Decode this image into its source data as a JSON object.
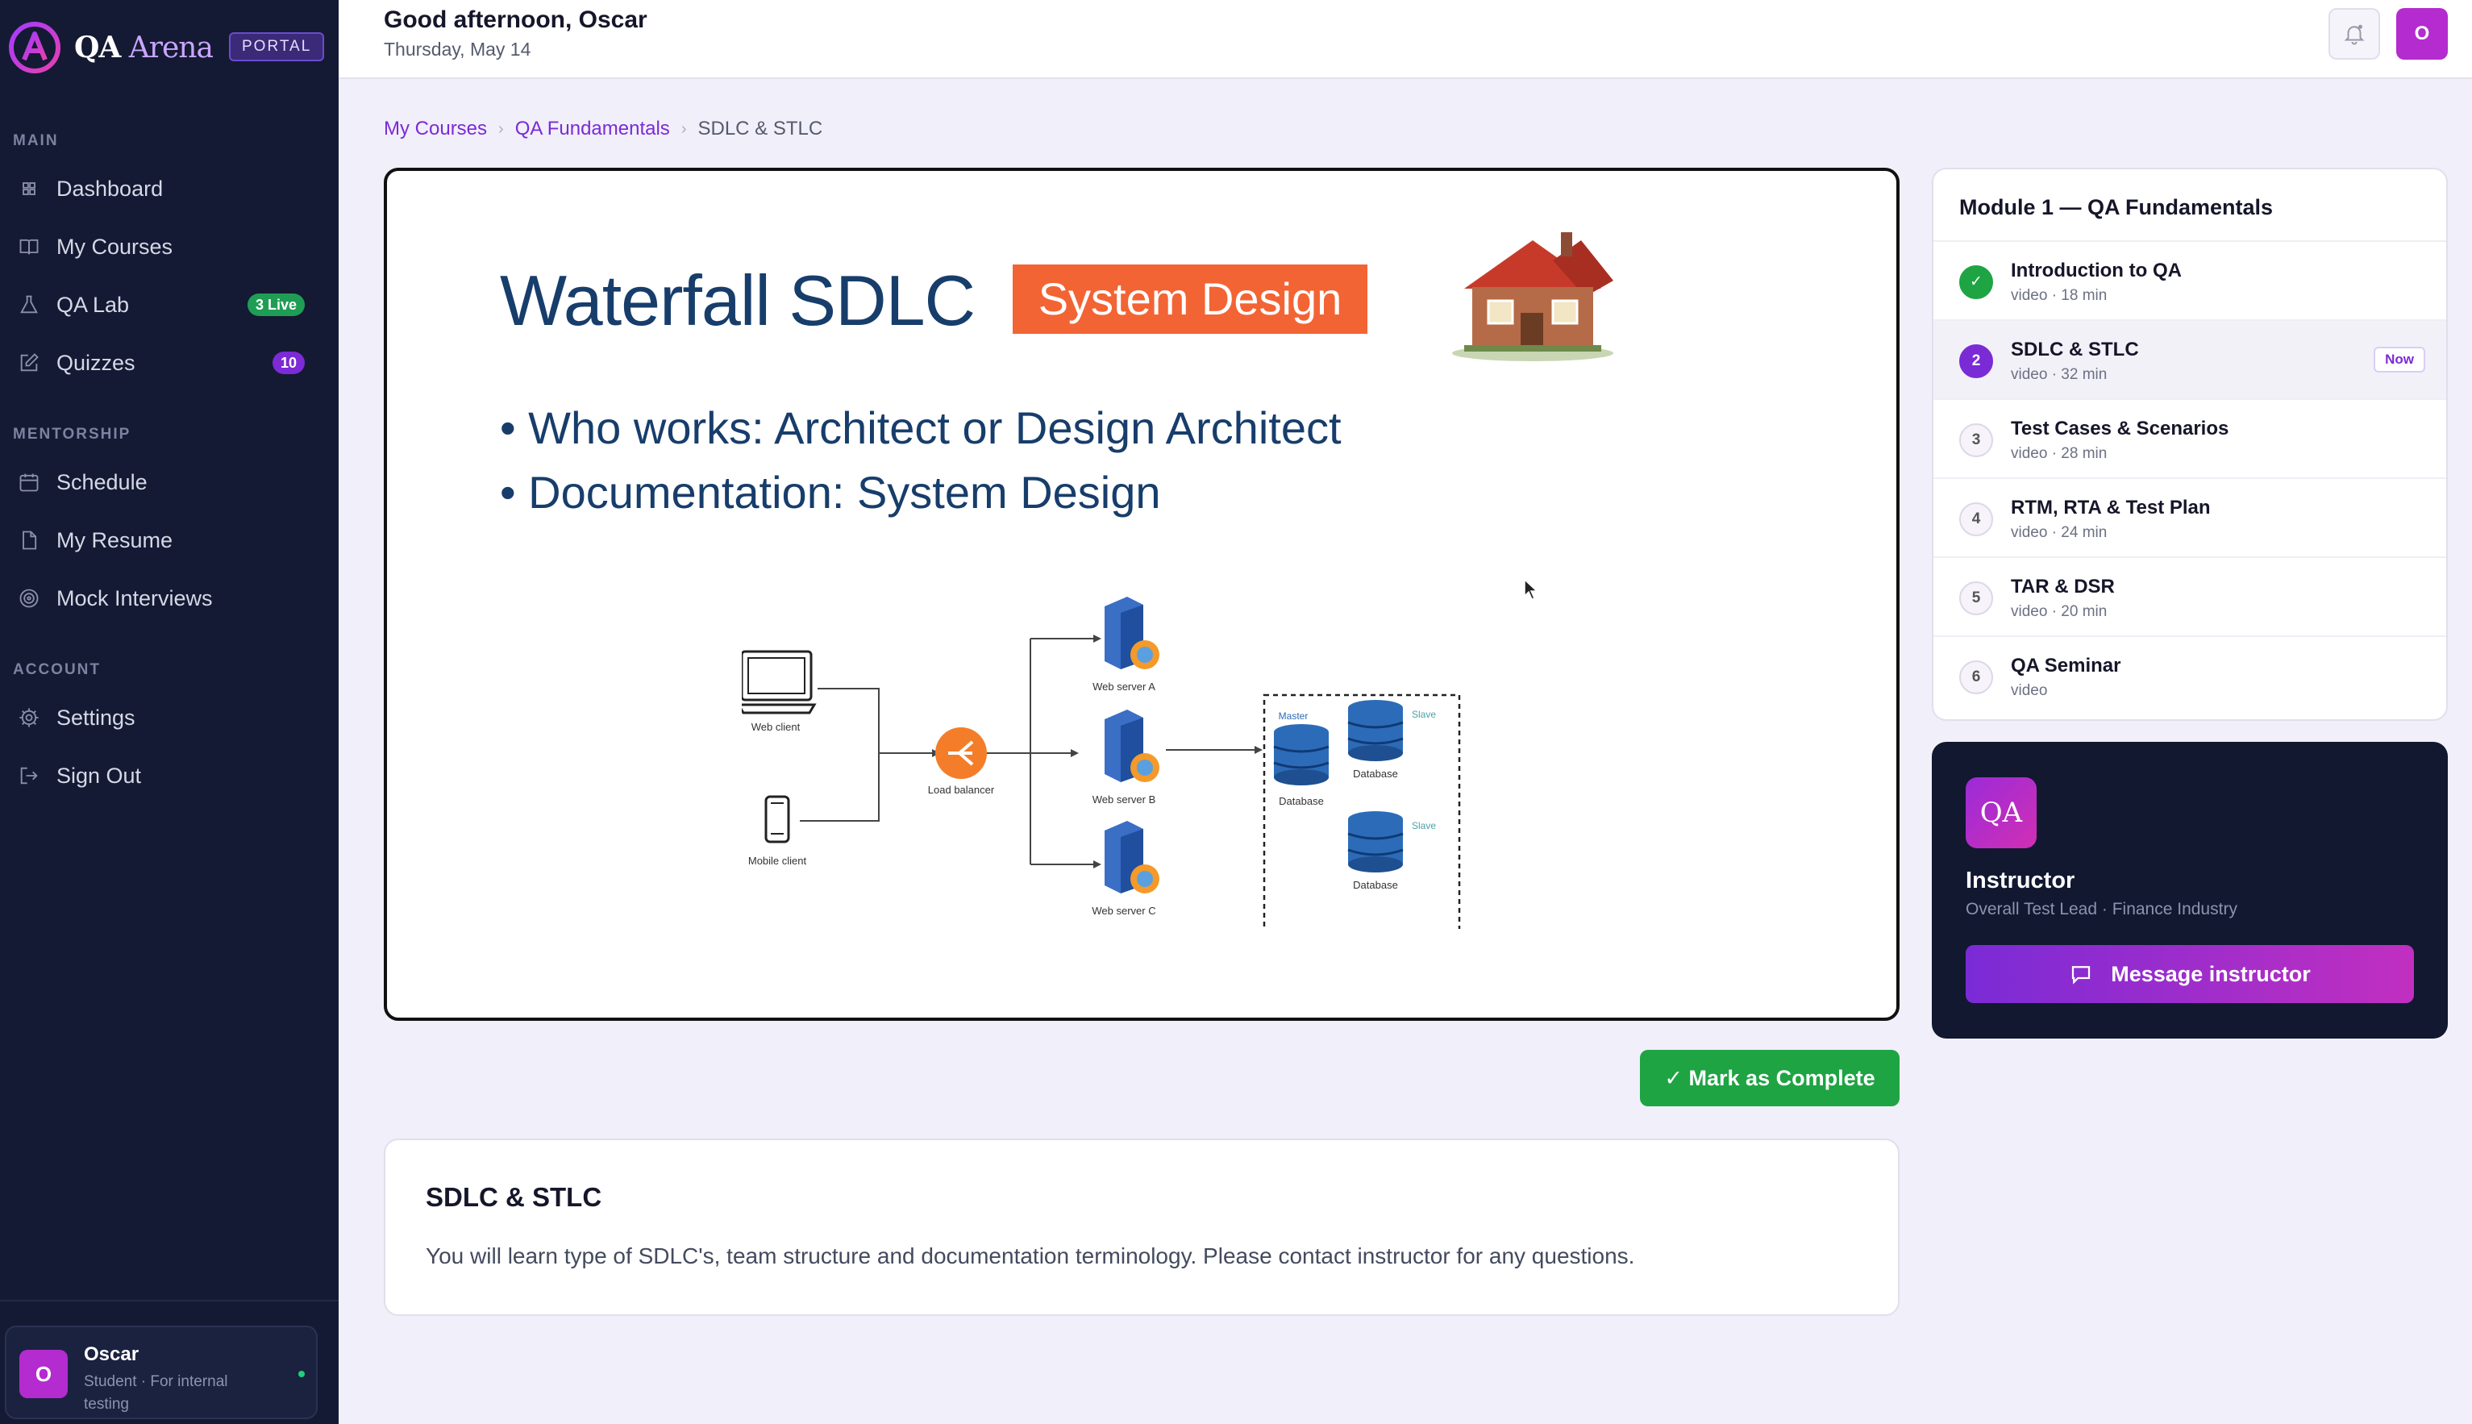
{
  "brand": {
    "name_main": "QA",
    "name_accent": "Arena",
    "portal_badge": "PORTAL"
  },
  "sidebar": {
    "sections": [
      {
        "label": "MAIN"
      },
      {
        "label": "MENTORSHIP"
      },
      {
        "label": "ACCOUNT"
      }
    ],
    "items": [
      {
        "label": "Dashboard",
        "icon": "grid-icon"
      },
      {
        "label": "My Courses",
        "icon": "book-icon"
      },
      {
        "label": "QA Lab",
        "icon": "flask-icon",
        "badge": "3 Live"
      },
      {
        "label": "Quizzes",
        "icon": "edit-icon",
        "badge": "10"
      },
      {
        "label": "Schedule",
        "icon": "calendar-icon"
      },
      {
        "label": "My Resume",
        "icon": "file-icon"
      },
      {
        "label": "Mock Interviews",
        "icon": "target-icon"
      },
      {
        "label": "Settings",
        "icon": "gear-icon"
      },
      {
        "label": "Sign Out",
        "icon": "logout-icon"
      }
    ],
    "user": {
      "initial": "O",
      "name": "Oscar",
      "role": "Student · For internal testing"
    }
  },
  "header": {
    "greeting": "Good afternoon, Oscar",
    "date": "Thursday, May 14",
    "avatar_initial": "O"
  },
  "breadcrumb": [
    "My Courses",
    "QA Fundamentals",
    "SDLC & STLC"
  ],
  "slide": {
    "title": "Waterfall SDLC",
    "tag": "System Design",
    "bullets": [
      "Who works: Architect or Design Architect",
      "Documentation: System Design"
    ],
    "diagram": {
      "web_client": "Web client",
      "mobile_client": "Mobile client",
      "load_balancer": "Load balancer",
      "server_a": "Web server A",
      "server_b": "Web server B",
      "server_c": "Web server C",
      "master": "Master",
      "slave": "Slave",
      "database": "Database"
    }
  },
  "actions": {
    "mark_complete": "✓ Mark as Complete"
  },
  "lesson_info": {
    "title": "SDLC & STLC",
    "description": "You will learn type of SDLC's, team structure and documentation terminology. Please contact instructor for any questions."
  },
  "module": {
    "title": "Module 1 — QA Fundamentals",
    "lessons": [
      {
        "num": "1",
        "title": "Introduction to QA",
        "meta": "video · 18 min",
        "state": "done"
      },
      {
        "num": "2",
        "title": "SDLC & STLC",
        "meta": "video · 32 min",
        "state": "current",
        "badge": "Now"
      },
      {
        "num": "3",
        "title": "Test Cases & Scenarios",
        "meta": "video · 28 min",
        "state": "todo"
      },
      {
        "num": "4",
        "title": "RTM, RTA & Test Plan",
        "meta": "video · 24 min",
        "state": "todo"
      },
      {
        "num": "5",
        "title": "TAR & DSR",
        "meta": "video · 20 min",
        "state": "todo"
      },
      {
        "num": "6",
        "title": "QA Seminar",
        "meta": "video",
        "state": "todo"
      }
    ]
  },
  "instructor": {
    "logo_text": "QA",
    "title": "Instructor",
    "subtitle": "Overall Test Lead · Finance Industry",
    "message_label": "Message instructor"
  },
  "colors": {
    "accent": "#7a2bd6",
    "success": "#1ea443",
    "sidebar_bg": "#141a33",
    "slide_blue": "#173d6b",
    "slide_orange": "#f36434"
  }
}
